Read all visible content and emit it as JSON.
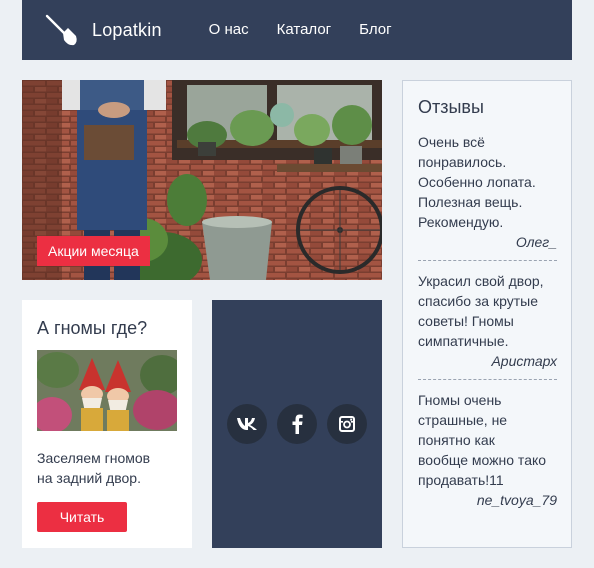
{
  "header": {
    "logo_text": "Lopatkin",
    "nav": [
      {
        "label": "О нас"
      },
      {
        "label": "Каталог"
      },
      {
        "label": "Блог"
      }
    ]
  },
  "hero": {
    "badge": "Акции месяца"
  },
  "card": {
    "title": "А гномы где?",
    "text_line1": "Заселяем гномов",
    "text_line2": "на задний двор.",
    "button": "Читать"
  },
  "social": {
    "icons": [
      "vk-icon",
      "facebook-icon",
      "instagram-icon"
    ]
  },
  "reviews": {
    "title": "Отзывы",
    "items": [
      {
        "lines": [
          "Очень всё",
          "понравилось.",
          "Особенно лопата.",
          "Полезная вещь.",
          "Рекомендую."
        ],
        "author": "Олег_"
      },
      {
        "lines": [
          "Украсил свой двор,",
          "спасибо за крутые",
          "советы! Гномы",
          "симпатичные."
        ],
        "author": "Аристарх"
      },
      {
        "lines": [
          "Гномы очень",
          "страшные, не",
          "понятно как",
          "вообще можно тако",
          "продавать!11"
        ],
        "author": "ne_tvoya_79"
      }
    ]
  },
  "colors": {
    "header_bg": "#33405a",
    "accent": "#ec2f42",
    "page_bg": "#ecf0f4"
  }
}
